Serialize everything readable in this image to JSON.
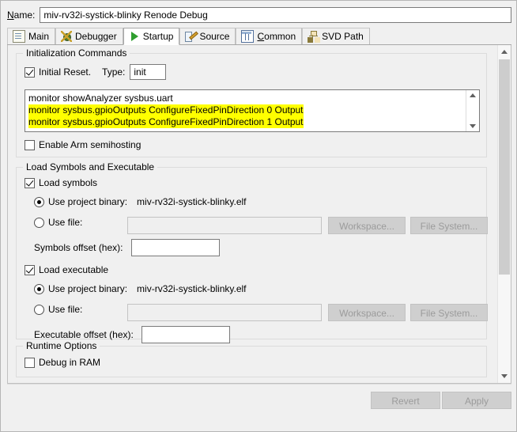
{
  "dialog": {
    "name_label": "Name:",
    "name_value": "miv-rv32i-systick-blinky Renode Debug"
  },
  "tabs": [
    {
      "label": "Main",
      "icon": "document-icon",
      "active": false
    },
    {
      "label": "Debugger",
      "icon": "bug-icon",
      "active": false
    },
    {
      "label": "Startup",
      "icon": "play-icon",
      "active": true
    },
    {
      "label": "Source",
      "icon": "source-icon",
      "active": false
    },
    {
      "label": "Common",
      "icon": "table-icon",
      "active": false
    },
    {
      "label": "SVD Path",
      "icon": "hierarchy-icon",
      "active": false
    }
  ],
  "init_commands": {
    "group_title": "Initialization Commands",
    "initial_reset_label": "Initial Reset.",
    "initial_reset_checked": true,
    "type_label": "Type:",
    "type_value": "init",
    "commands": [
      {
        "text": "monitor showAnalyzer sysbus.uart",
        "highlighted": false
      },
      {
        "text": "monitor sysbus.gpioOutputs ConfigureFixedPinDirection 0 Output",
        "highlighted": true
      },
      {
        "text": "monitor sysbus.gpioOutputs ConfigureFixedPinDirection 1 Output",
        "highlighted": true
      }
    ],
    "semihosting_label": "Enable Arm semihosting",
    "semihosting_checked": false
  },
  "load_section": {
    "group_title": "Load Symbols and Executable",
    "load_symbols_label": "Load symbols",
    "load_symbols_checked": true,
    "symbols_project_binary_label": "Use project binary:",
    "symbols_project_binary_value": "miv-rv32i-systick-blinky.elf",
    "symbols_project_binary_selected": true,
    "symbols_use_file_label": "Use file:",
    "symbols_use_file_selected": false,
    "symbols_use_file_value": "",
    "symbols_workspace_button": "Workspace...",
    "symbols_filesystem_button": "File System...",
    "symbols_offset_label": "Symbols offset (hex):",
    "symbols_offset_value": "",
    "load_executable_label": "Load executable",
    "load_executable_checked": true,
    "exec_project_binary_label": "Use project binary:",
    "exec_project_binary_value": "miv-rv32i-systick-blinky.elf",
    "exec_project_binary_selected": true,
    "exec_use_file_label": "Use file:",
    "exec_use_file_selected": false,
    "exec_use_file_value": "",
    "exec_workspace_button": "Workspace...",
    "exec_filesystem_button": "File System...",
    "exec_offset_label": "Executable offset (hex):",
    "exec_offset_value": ""
  },
  "runtime_options": {
    "group_title": "Runtime Options",
    "debug_in_ram_label": "Debug in RAM",
    "debug_in_ram_checked": false
  },
  "footer": {
    "revert_label": "Revert",
    "apply_label": "Apply",
    "revert_enabled": false,
    "apply_enabled": false
  },
  "colors": {
    "highlight": "#ffff00",
    "dialog_bg": "#f0f0f0",
    "field_bg": "#ffffff",
    "disabled_text": "#9b9b9b"
  }
}
